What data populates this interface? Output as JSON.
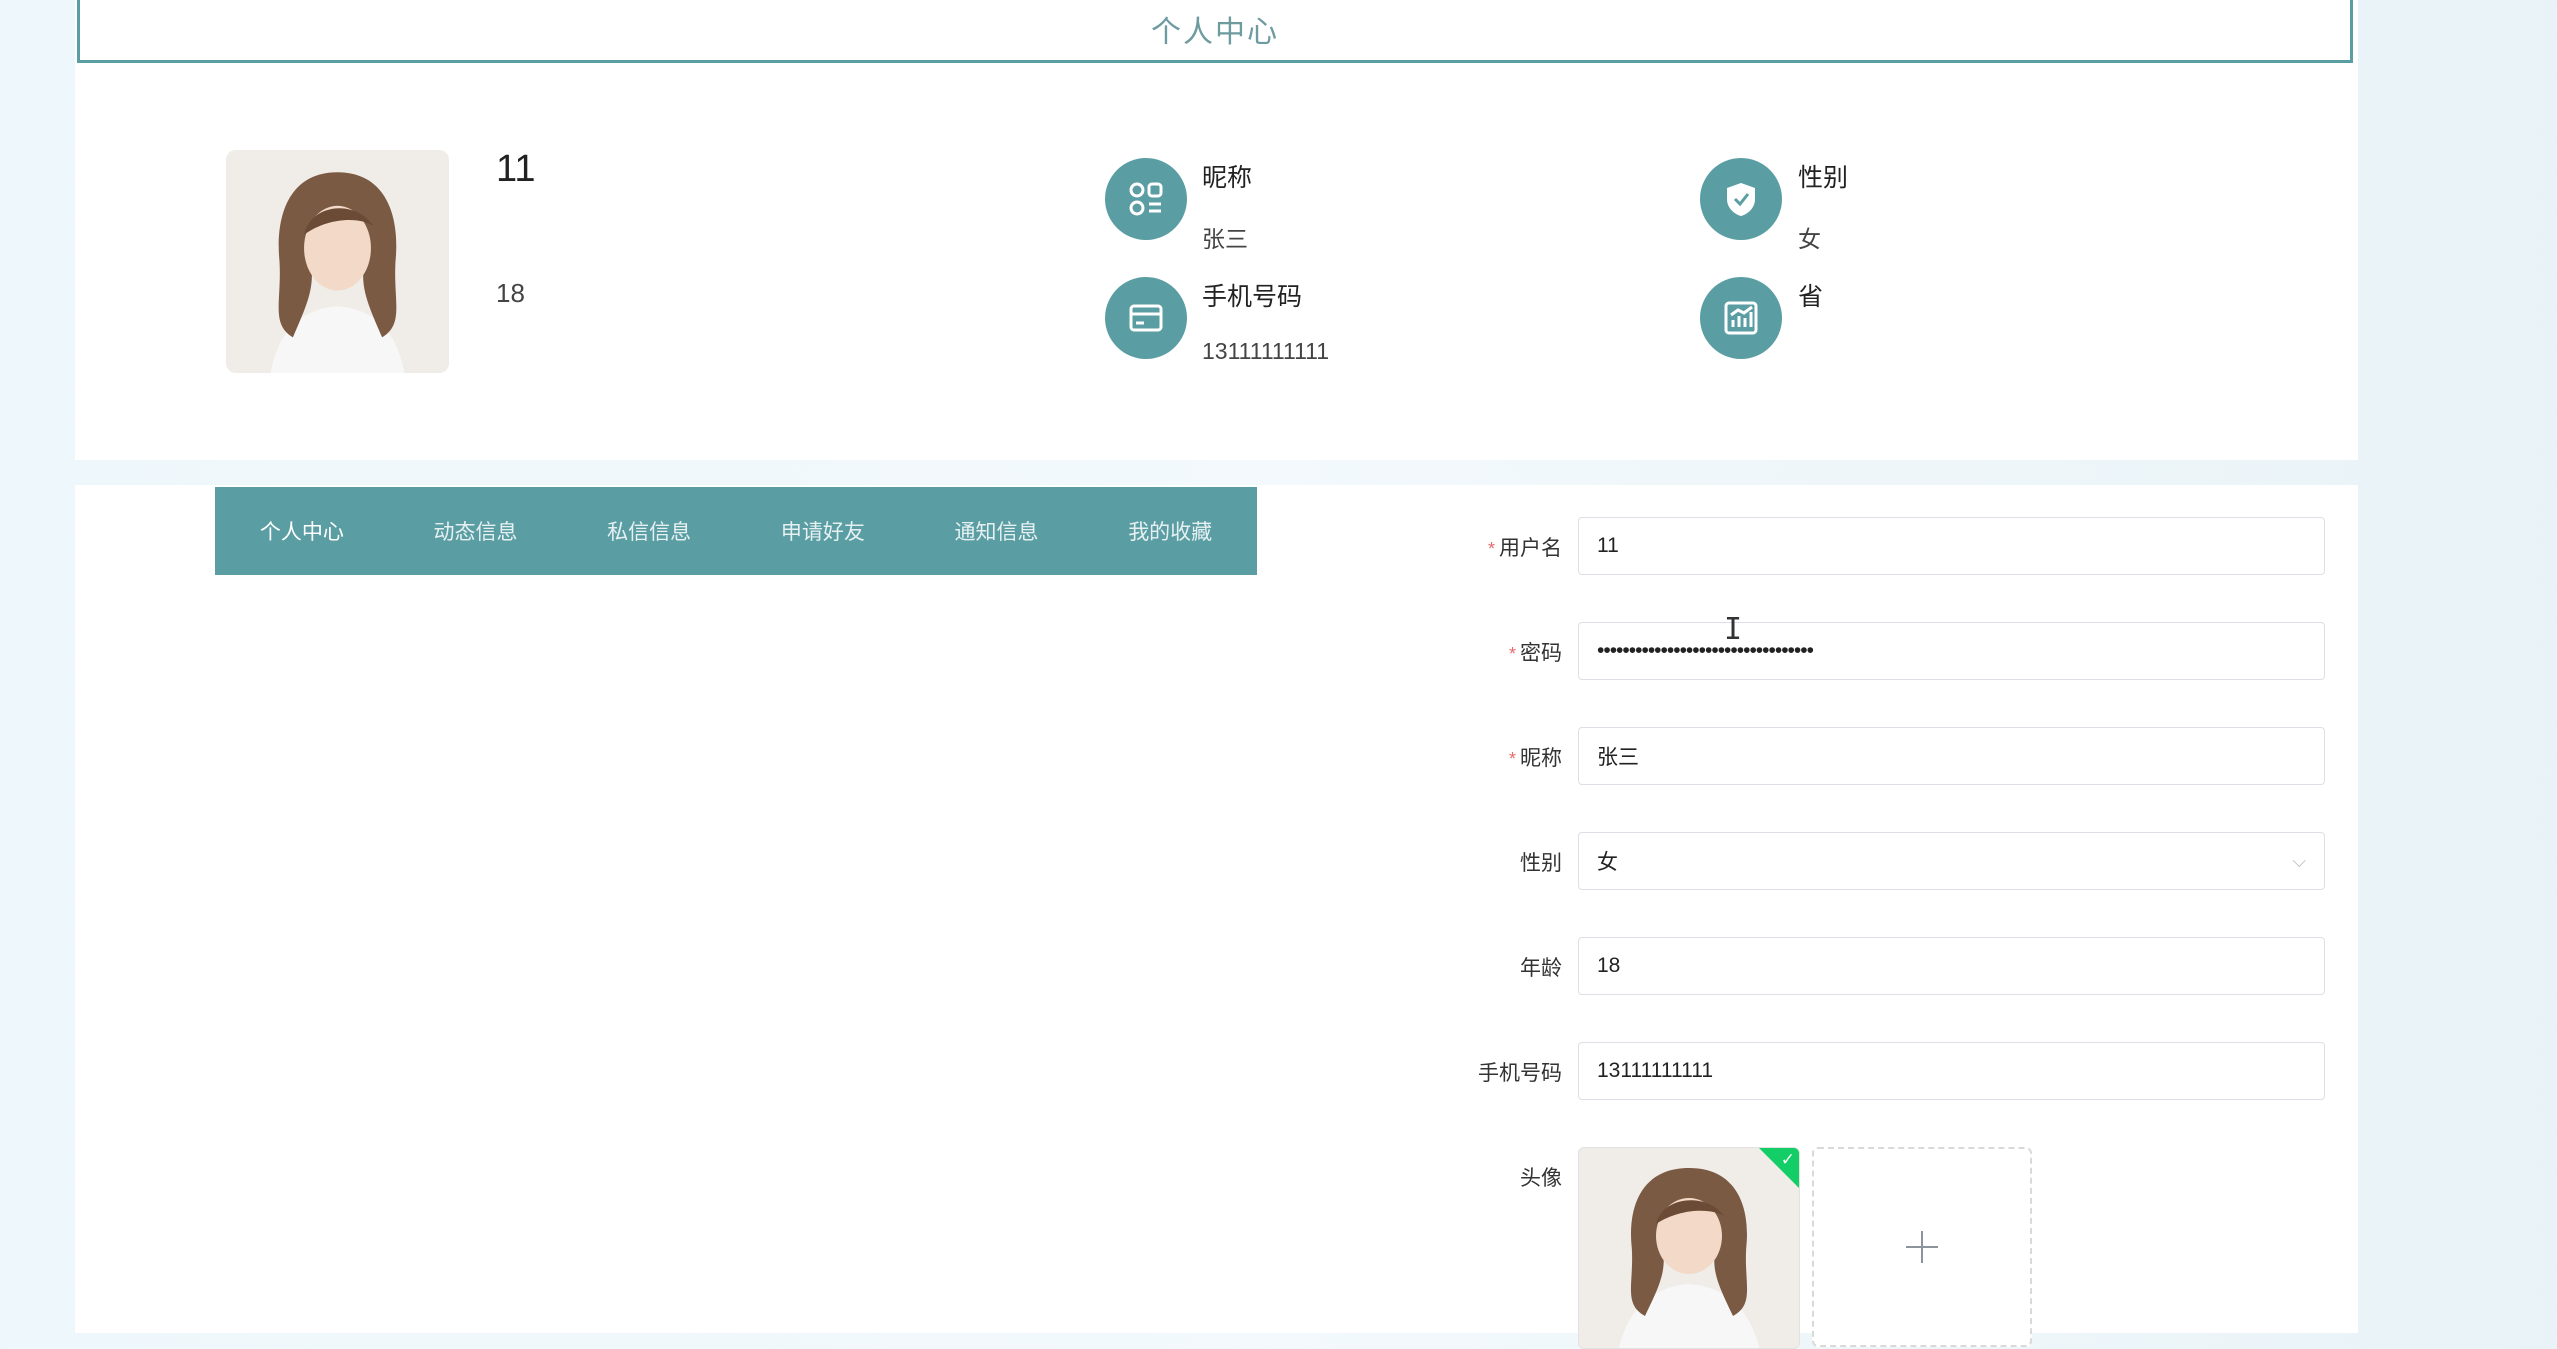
{
  "header": {
    "title": "个人中心"
  },
  "profile": {
    "username": "11",
    "age": "18",
    "info": [
      {
        "label": "昵称",
        "value": "张三",
        "icon": "apps-icon"
      },
      {
        "label": "性别",
        "value": "女",
        "icon": "shield-icon"
      },
      {
        "label": "手机号码",
        "value": "13111111111",
        "icon": "card-icon"
      },
      {
        "label": "省",
        "value": "",
        "icon": "chart-icon"
      }
    ]
  },
  "tabs": [
    "个人中心",
    "动态信息",
    "私信信息",
    "申请好友",
    "通知信息",
    "我的收藏"
  ],
  "form": {
    "username_label": "用户名",
    "username_value": "11",
    "password_label": "密码",
    "password_value": "••••••••••••••••••••••••••••••••••",
    "nickname_label": "昵称",
    "nickname_value": "张三",
    "gender_label": "性别",
    "gender_value": "女",
    "age_label": "年龄",
    "age_value": "18",
    "phone_label": "手机号码",
    "phone_value": "13111111111",
    "avatar_label": "头像"
  },
  "colors": {
    "accent": "#5a9ea4",
    "success": "#13ce66",
    "required": "#e86b6b"
  }
}
